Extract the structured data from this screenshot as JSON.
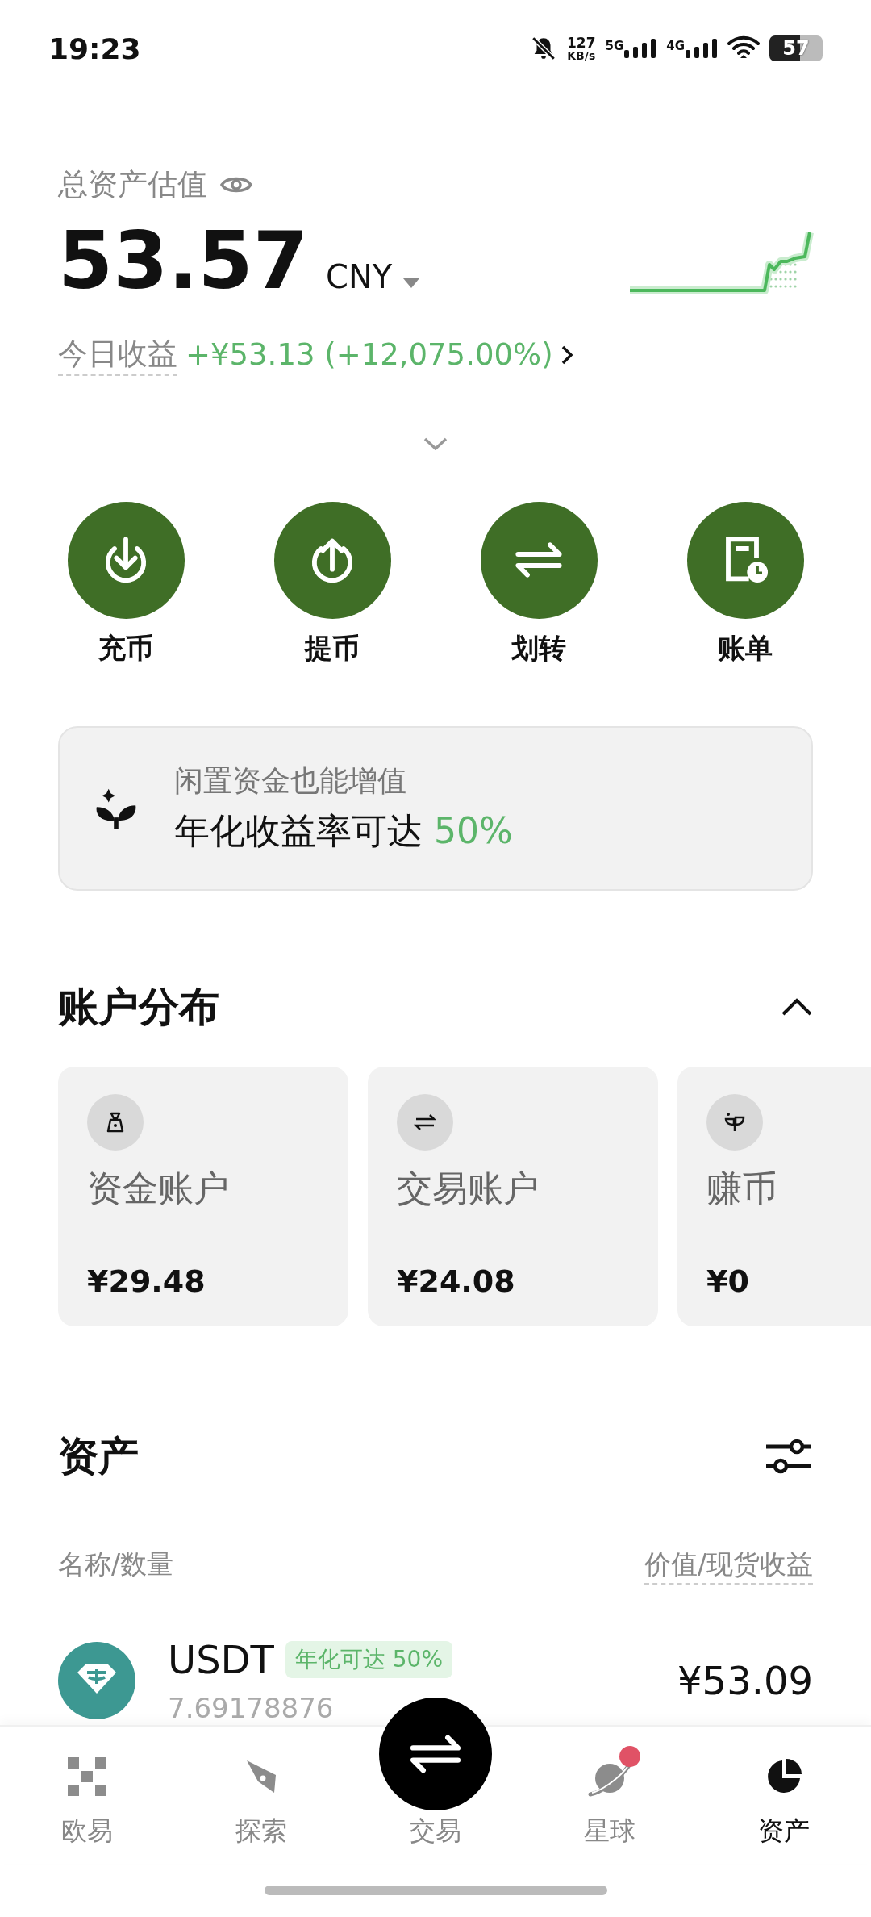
{
  "status_bar": {
    "time": "19:23",
    "net_speed": "127",
    "net_unit": "KB/s",
    "signals": [
      "5G",
      "4G"
    ],
    "battery": "57"
  },
  "summary": {
    "label": "总资产估值",
    "total": "53.57",
    "currency": "CNY",
    "today_label": "今日收益",
    "today_change": "+¥53.13 (+12,075.00%)"
  },
  "actions": [
    {
      "label": "充币"
    },
    {
      "label": "提币"
    },
    {
      "label": "划转"
    },
    {
      "label": "账单"
    }
  ],
  "promo": {
    "subtitle": "闲置资金也能增值",
    "title": "年化收益率可达 **50%**"
  },
  "accounts": {
    "title": "账户分布",
    "expanded": true,
    "cards": [
      {
        "name": "资金账户",
        "amount": "¥29.48"
      },
      {
        "name": "交易账户",
        "amount": "¥24.08"
      },
      {
        "name": "赚币",
        "amount": "¥0"
      }
    ]
  },
  "assets": {
    "title": "资产",
    "column_left": "名称/数量",
    "column_right": "价值/现货收益",
    "rows": [
      {
        "symbol": "USDT",
        "tag": "年化可达 50%",
        "quantity": "7.69178876",
        "value": "¥53.09"
      }
    ]
  },
  "nav": [
    {
      "label": "欧易",
      "kind": "tab",
      "selected": false,
      "badge": false
    },
    {
      "label": "探索",
      "kind": "tab",
      "selected": false,
      "badge": false
    },
    {
      "label": "交易",
      "kind": "center",
      "selected": false,
      "badge": false
    },
    {
      "label": "星球",
      "kind": "tab",
      "selected": false,
      "badge": true
    },
    {
      "label": "资产",
      "kind": "tab",
      "selected": true,
      "badge": false
    }
  ]
}
